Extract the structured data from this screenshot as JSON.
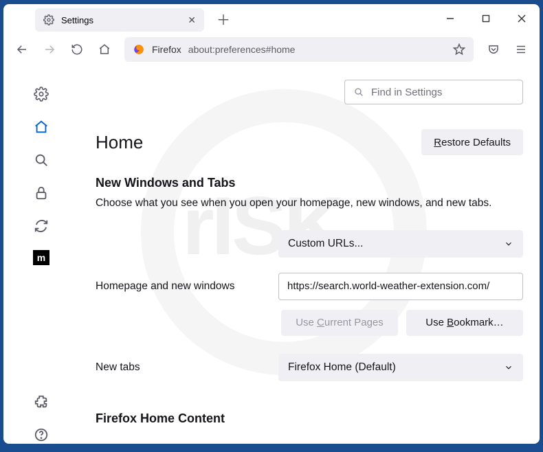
{
  "tab": {
    "title": "Settings"
  },
  "url": {
    "identity": "Firefox",
    "address": "about:preferences#home"
  },
  "search": {
    "placeholder": "Find in Settings"
  },
  "page": {
    "title": "Home",
    "restore": "Restore Defaults",
    "section1": {
      "heading": "New Windows and Tabs",
      "desc": "Choose what you see when you open your homepage, new windows, and new tabs."
    },
    "homepage": {
      "label": "Homepage and new windows",
      "select": "Custom URLs...",
      "url": "https://search.world-weather-extension.com/",
      "use_current": "Use Current Pages",
      "use_bookmark": "Use Bookmark…"
    },
    "newtabs": {
      "label": "New tabs",
      "select": "Firefox Home (Default)"
    },
    "section2": {
      "heading": "Firefox Home Content"
    }
  }
}
